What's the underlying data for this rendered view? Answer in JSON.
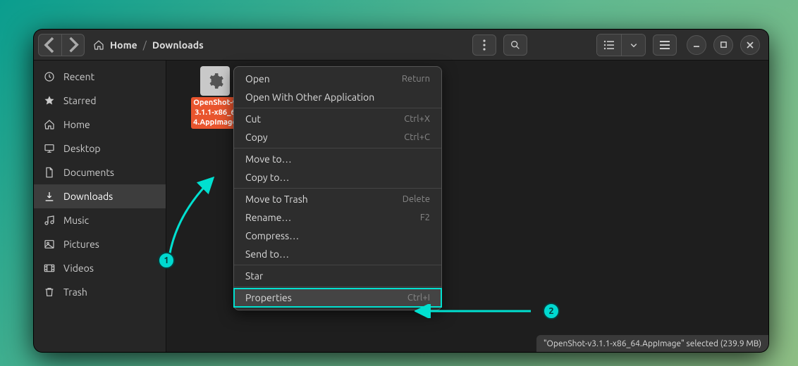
{
  "breadcrumb": {
    "root": "Home",
    "current": "Downloads"
  },
  "sidebar": {
    "items": [
      {
        "label": "Recent"
      },
      {
        "label": "Starred"
      },
      {
        "label": "Home"
      },
      {
        "label": "Desktop"
      },
      {
        "label": "Documents"
      },
      {
        "label": "Downloads"
      },
      {
        "label": "Music"
      },
      {
        "label": "Pictures"
      },
      {
        "label": "Videos"
      },
      {
        "label": "Trash"
      }
    ]
  },
  "file": {
    "name_lines": "OpenShot-v3.1.1-x86_64.AppImage"
  },
  "context_menu": {
    "open": "Open",
    "open_accel": "Return",
    "open_with": "Open With Other Application",
    "cut": "Cut",
    "cut_accel": "Ctrl+X",
    "copy": "Copy",
    "copy_accel": "Ctrl+C",
    "move_to": "Move to…",
    "copy_to": "Copy to…",
    "trash": "Move to Trash",
    "trash_accel": "Delete",
    "rename": "Rename…",
    "rename_accel": "F2",
    "compress": "Compress…",
    "send_to": "Send to…",
    "star": "Star",
    "properties": "Properties",
    "properties_accel": "Ctrl+I"
  },
  "statusbar": {
    "text": "\"OpenShot-v3.1.1-x86_64.AppImage\" selected  (239.9 MB)"
  },
  "annotations": {
    "one": "1",
    "two": "2"
  }
}
